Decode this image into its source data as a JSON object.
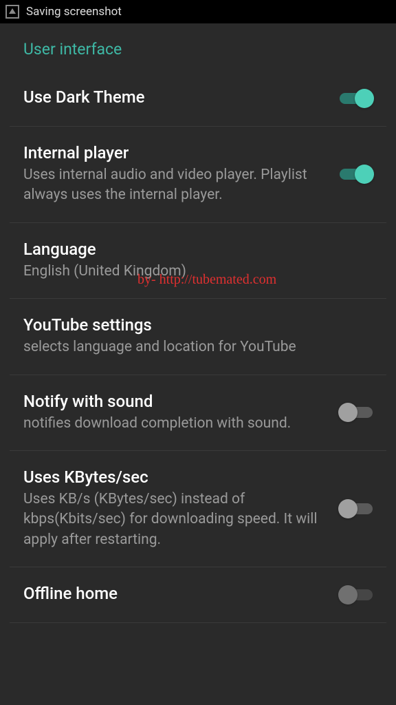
{
  "notification": {
    "text": "Saving screenshot"
  },
  "section_header": "User interface",
  "settings": {
    "dark_theme": {
      "title": "Use Dark Theme",
      "enabled": true
    },
    "internal_player": {
      "title": "Internal player",
      "description": "Uses internal audio and video player. Playlist always uses the internal player.",
      "enabled": true
    },
    "language": {
      "title": "Language",
      "description": "English (United Kingdom)"
    },
    "youtube_settings": {
      "title": "YouTube settings",
      "description": "selects language and location for YouTube"
    },
    "notify_sound": {
      "title": "Notify with sound",
      "description": "notifies download completion with sound.",
      "enabled": false
    },
    "kbytes": {
      "title": "Uses KBytes/sec",
      "description": "Uses KB/s (KBytes/sec) instead of kbps(Kbits/sec) for downloading speed. It will apply after restarting.",
      "enabled": false
    },
    "offline_home": {
      "title": "Offline home"
    }
  },
  "watermark": "by- http://tubemated.com"
}
